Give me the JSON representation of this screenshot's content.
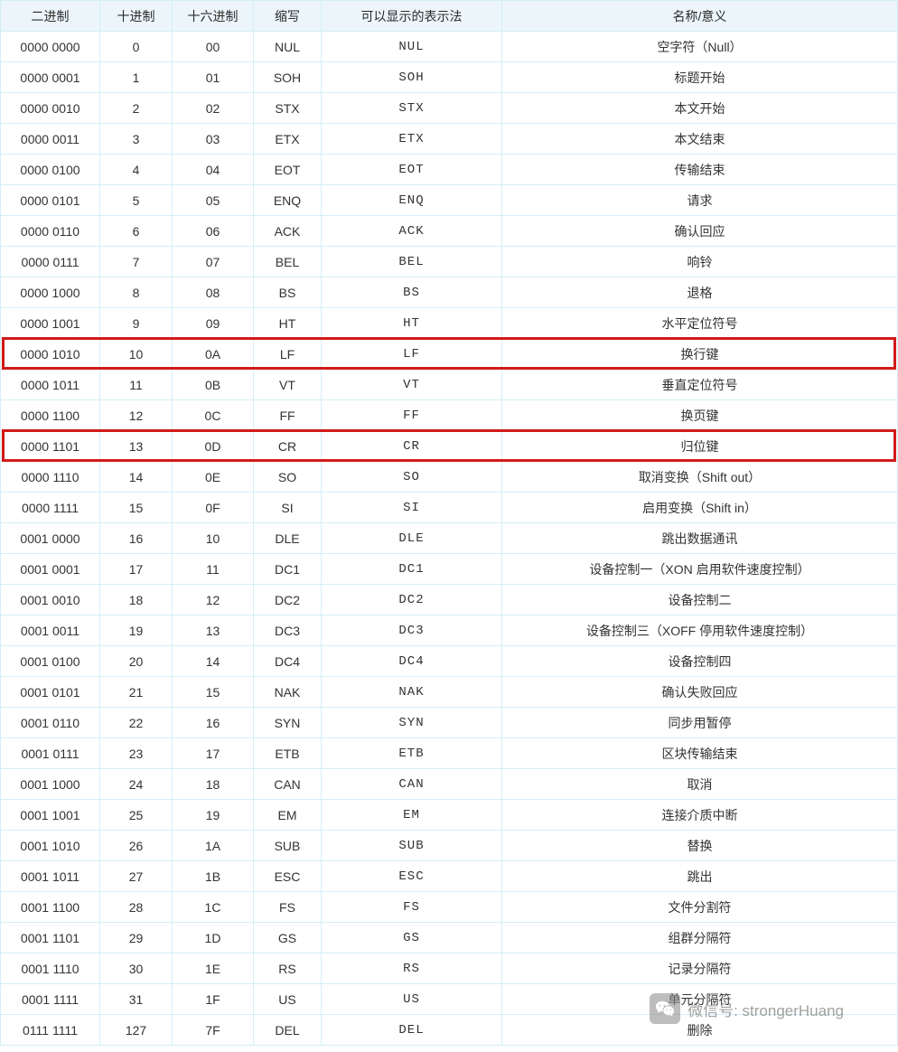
{
  "headers": {
    "binary": "二进制",
    "decimal": "十进制",
    "hex": "十六进制",
    "abbr": "缩写",
    "display": "可以显示的表示法",
    "name": "名称/意义"
  },
  "rows": [
    {
      "bin": "0000 0000",
      "dec": "0",
      "hex": "00",
      "abbr": "NUL",
      "disp": "NUL",
      "name": "空字符（Null）",
      "hl": false
    },
    {
      "bin": "0000 0001",
      "dec": "1",
      "hex": "01",
      "abbr": "SOH",
      "disp": "SOH",
      "name": "标题开始",
      "hl": false
    },
    {
      "bin": "0000 0010",
      "dec": "2",
      "hex": "02",
      "abbr": "STX",
      "disp": "STX",
      "name": "本文开始",
      "hl": false
    },
    {
      "bin": "0000 0011",
      "dec": "3",
      "hex": "03",
      "abbr": "ETX",
      "disp": "ETX",
      "name": "本文结束",
      "hl": false
    },
    {
      "bin": "0000 0100",
      "dec": "4",
      "hex": "04",
      "abbr": "EOT",
      "disp": "EOT",
      "name": "传输结束",
      "hl": false
    },
    {
      "bin": "0000 0101",
      "dec": "5",
      "hex": "05",
      "abbr": "ENQ",
      "disp": "ENQ",
      "name": "请求",
      "hl": false
    },
    {
      "bin": "0000 0110",
      "dec": "6",
      "hex": "06",
      "abbr": "ACK",
      "disp": "ACK",
      "name": "确认回应",
      "hl": false
    },
    {
      "bin": "0000 0111",
      "dec": "7",
      "hex": "07",
      "abbr": "BEL",
      "disp": "BEL",
      "name": "响铃",
      "hl": false
    },
    {
      "bin": "0000 1000",
      "dec": "8",
      "hex": "08",
      "abbr": "BS",
      "disp": "BS",
      "name": "退格",
      "hl": false
    },
    {
      "bin": "0000 1001",
      "dec": "9",
      "hex": "09",
      "abbr": "HT",
      "disp": "HT",
      "name": "水平定位符号",
      "hl": false
    },
    {
      "bin": "0000 1010",
      "dec": "10",
      "hex": "0A",
      "abbr": "LF",
      "disp": "LF",
      "name": "换行键",
      "hl": true
    },
    {
      "bin": "0000 1011",
      "dec": "11",
      "hex": "0B",
      "abbr": "VT",
      "disp": "VT",
      "name": "垂直定位符号",
      "hl": false
    },
    {
      "bin": "0000 1100",
      "dec": "12",
      "hex": "0C",
      "abbr": "FF",
      "disp": "FF",
      "name": "换页键",
      "hl": false
    },
    {
      "bin": "0000 1101",
      "dec": "13",
      "hex": "0D",
      "abbr": "CR",
      "disp": "CR",
      "name": "归位键",
      "hl": true
    },
    {
      "bin": "0000 1110",
      "dec": "14",
      "hex": "0E",
      "abbr": "SO",
      "disp": "SO",
      "name": "取消变换（Shift out）",
      "hl": false
    },
    {
      "bin": "0000 1111",
      "dec": "15",
      "hex": "0F",
      "abbr": "SI",
      "disp": "SI",
      "name": "启用变换（Shift in）",
      "hl": false
    },
    {
      "bin": "0001 0000",
      "dec": "16",
      "hex": "10",
      "abbr": "DLE",
      "disp": "DLE",
      "name": "跳出数据通讯",
      "hl": false
    },
    {
      "bin": "0001 0001",
      "dec": "17",
      "hex": "11",
      "abbr": "DC1",
      "disp": "DC1",
      "name": "设备控制一（XON 启用软件速度控制）",
      "hl": false
    },
    {
      "bin": "0001 0010",
      "dec": "18",
      "hex": "12",
      "abbr": "DC2",
      "disp": "DC2",
      "name": "设备控制二",
      "hl": false
    },
    {
      "bin": "0001 0011",
      "dec": "19",
      "hex": "13",
      "abbr": "DC3",
      "disp": "DC3",
      "name": "设备控制三（XOFF 停用软件速度控制）",
      "hl": false
    },
    {
      "bin": "0001 0100",
      "dec": "20",
      "hex": "14",
      "abbr": "DC4",
      "disp": "DC4",
      "name": "设备控制四",
      "hl": false
    },
    {
      "bin": "0001 0101",
      "dec": "21",
      "hex": "15",
      "abbr": "NAK",
      "disp": "NAK",
      "name": "确认失败回应",
      "hl": false
    },
    {
      "bin": "0001 0110",
      "dec": "22",
      "hex": "16",
      "abbr": "SYN",
      "disp": "SYN",
      "name": "同步用暂停",
      "hl": false
    },
    {
      "bin": "0001 0111",
      "dec": "23",
      "hex": "17",
      "abbr": "ETB",
      "disp": "ETB",
      "name": "区块传输结束",
      "hl": false
    },
    {
      "bin": "0001 1000",
      "dec": "24",
      "hex": "18",
      "abbr": "CAN",
      "disp": "CAN",
      "name": "取消",
      "hl": false
    },
    {
      "bin": "0001 1001",
      "dec": "25",
      "hex": "19",
      "abbr": "EM",
      "disp": "EM",
      "name": "连接介质中断",
      "hl": false
    },
    {
      "bin": "0001 1010",
      "dec": "26",
      "hex": "1A",
      "abbr": "SUB",
      "disp": "SUB",
      "name": "替换",
      "hl": false
    },
    {
      "bin": "0001 1011",
      "dec": "27",
      "hex": "1B",
      "abbr": "ESC",
      "disp": "ESC",
      "name": "跳出",
      "hl": false
    },
    {
      "bin": "0001 1100",
      "dec": "28",
      "hex": "1C",
      "abbr": "FS",
      "disp": "FS",
      "name": "文件分割符",
      "hl": false
    },
    {
      "bin": "0001 1101",
      "dec": "29",
      "hex": "1D",
      "abbr": "GS",
      "disp": "GS",
      "name": "组群分隔符",
      "hl": false
    },
    {
      "bin": "0001 1110",
      "dec": "30",
      "hex": "1E",
      "abbr": "RS",
      "disp": "RS",
      "name": "记录分隔符",
      "hl": false
    },
    {
      "bin": "0001 1111",
      "dec": "31",
      "hex": "1F",
      "abbr": "US",
      "disp": "US",
      "name": "单元分隔符",
      "hl": false
    },
    {
      "bin": "0111 1111",
      "dec": "127",
      "hex": "7F",
      "abbr": "DEL",
      "disp": "DEL",
      "name": "删除",
      "hl": false
    }
  ],
  "watermark": {
    "label": "微信号: strongerHuang"
  },
  "colors": {
    "border": "#d4eef7",
    "header_bg": "#ecf6fa",
    "highlight": "#d11a1a"
  }
}
